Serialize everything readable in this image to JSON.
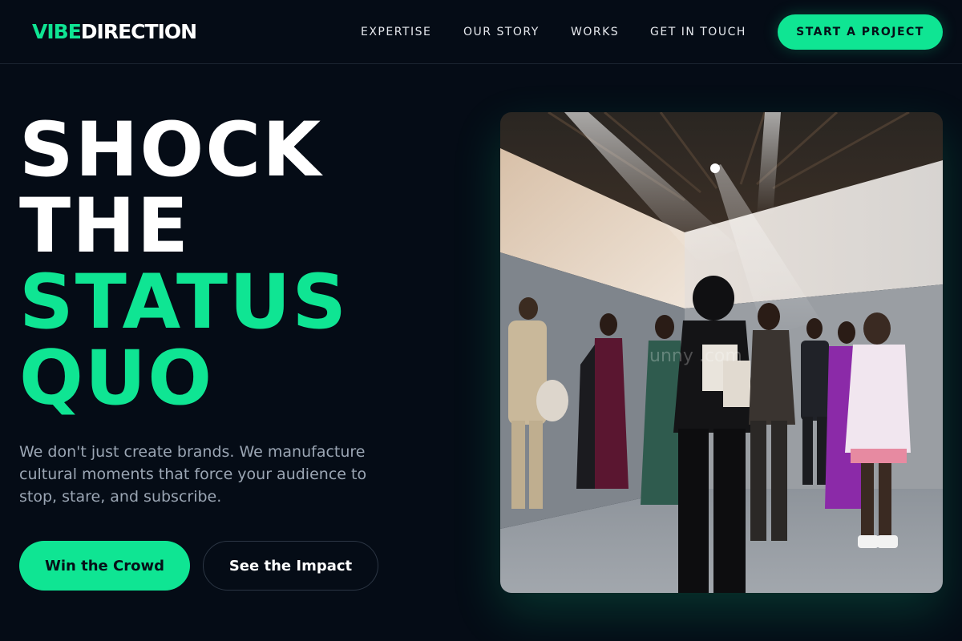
{
  "header": {
    "logo_accent": "VIBE",
    "logo_main": "DIRECTION",
    "nav": [
      "EXPERTISE",
      "OUR STORY",
      "WORKS",
      "GET IN TOUCH"
    ],
    "cta": "START A PROJECT"
  },
  "hero": {
    "headline": [
      "SHOCK",
      "THE",
      "STATUS",
      "QUO"
    ],
    "subcopy": "We don't just create brands. We manufacture cultural moments that force your audience to stop, stare, and subscribe.",
    "primary_button": "Win the Crowd",
    "secondary_button": "See the Impact"
  },
  "image": {
    "watermark": "unny .com"
  },
  "colors": {
    "background": "#050c16",
    "accent": "#0fe593",
    "text_muted": "#9ba6b4"
  }
}
